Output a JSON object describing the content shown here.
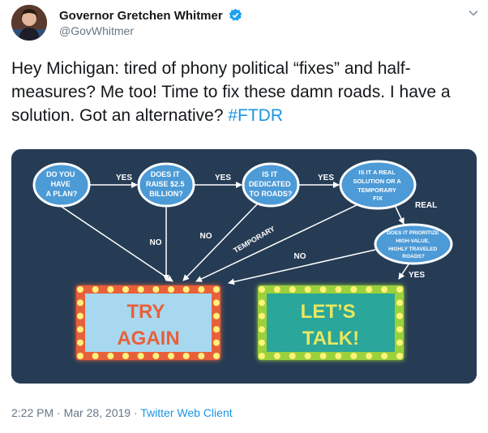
{
  "tweet": {
    "author_name": "Governor Gretchen Whitmer",
    "handle": "@GovWhitmer",
    "text_main": "Hey Michigan: tired of phony political “fixes” and half-measures?  Me too!  Time to fix these damn roads. I have a solution. Got an alternative? ",
    "hashtag": "#FTDR",
    "timestamp": "2:22 PM · Mar 28, 2019",
    "separator": " · ",
    "client": "Twitter Web Client"
  },
  "flowchart": {
    "nodes": {
      "plan": [
        "DO YOU",
        "HAVE",
        "A PLAN?"
      ],
      "raise": [
        "DOES IT",
        "RAISE $2.5",
        "BILLION?"
      ],
      "dedicated": [
        "IS IT",
        "DEDICATED",
        "TO ROADS?"
      ],
      "solution": [
        "IS IT A REAL",
        "SOLUTION OR A",
        "TEMPORARY",
        "FIX"
      ],
      "prioritize": [
        "DOES IT PRIORITIZE",
        "HIGH-VALUE,",
        "HIGHLY TRAVELED",
        "ROADS?"
      ]
    },
    "labels": {
      "yes": "YES",
      "no": "NO",
      "real": "REAL",
      "temporary": "TEMPORARY"
    },
    "outcomes": {
      "try_again": [
        "TRY",
        "AGAIN"
      ],
      "lets_talk": [
        "LET’S",
        "TALK!"
      ]
    },
    "colors": {
      "background": "#263c55",
      "node_fill": "#4c9ad6",
      "try_fill": "#a8d8f0",
      "try_frame": "#e8603a",
      "try_text": "#e8603a",
      "talk_fill": "#2aa69a",
      "talk_frame": "#9bd13a",
      "talk_text": "#e8e860",
      "bulb": "#fff27a"
    }
  }
}
